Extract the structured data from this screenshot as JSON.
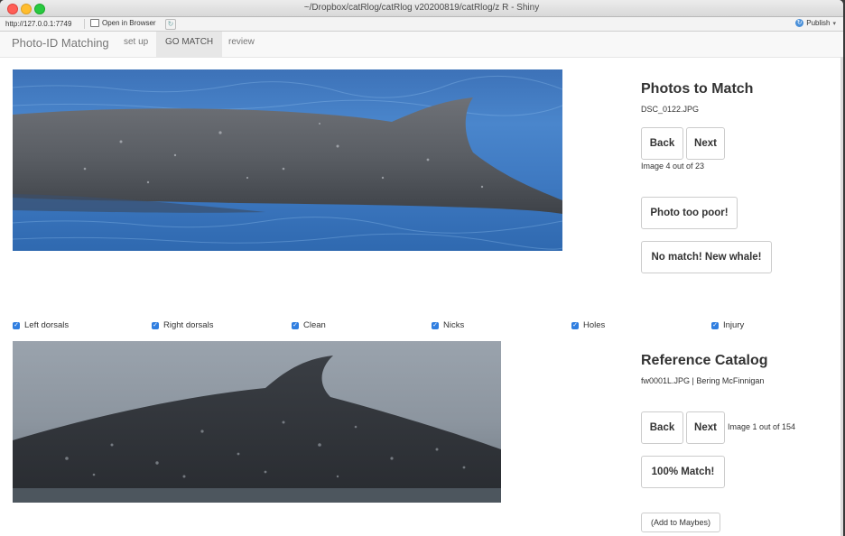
{
  "window": {
    "title": "~/Dropbox/catRlog/catRlog v20200819/catRlog/z R - Shiny"
  },
  "toolbar": {
    "url": "http://127.0.0.1:7749",
    "open_in_browser": "Open in Browser",
    "publish": "Publish"
  },
  "navbar": {
    "brand": "Photo-ID Matching",
    "tabs": [
      {
        "label": "set up"
      },
      {
        "label": "GO MATCH"
      },
      {
        "label": "review"
      }
    ],
    "active_tab": "GO MATCH"
  },
  "photos_to_match": {
    "heading": "Photos to Match",
    "filename": "DSC_0122.JPG",
    "back_label": "Back",
    "next_label": "Next",
    "counter": "Image 4 out of 23",
    "poor_label": "Photo too poor!",
    "no_match_label": "No match! New whale!"
  },
  "filters": [
    {
      "label": "Left dorsals",
      "checked": true
    },
    {
      "label": "Right dorsals",
      "checked": true
    },
    {
      "label": "Clean",
      "checked": true
    },
    {
      "label": "Nicks",
      "checked": true
    },
    {
      "label": "Holes",
      "checked": true
    },
    {
      "label": "Injury",
      "checked": true
    }
  ],
  "reference_catalog": {
    "heading": "Reference Catalog",
    "info": "fw0001L.JPG | Bering McFinnigan",
    "back_label": "Back",
    "next_label": "Next",
    "counter": "Image 1 out of 154",
    "match_label": "100% Match!",
    "maybe_label": "(Add to Maybes)"
  },
  "colors": {
    "checkbox": "#2f7ee0",
    "water": "#3f7ac2",
    "whale": "#585d63"
  },
  "icons": [
    "close-dot",
    "minimize-dot",
    "maximize-dot",
    "open-in-browser-icon",
    "refresh-icon",
    "publish-icon",
    "chevron-down-icon",
    "check-icon"
  ]
}
